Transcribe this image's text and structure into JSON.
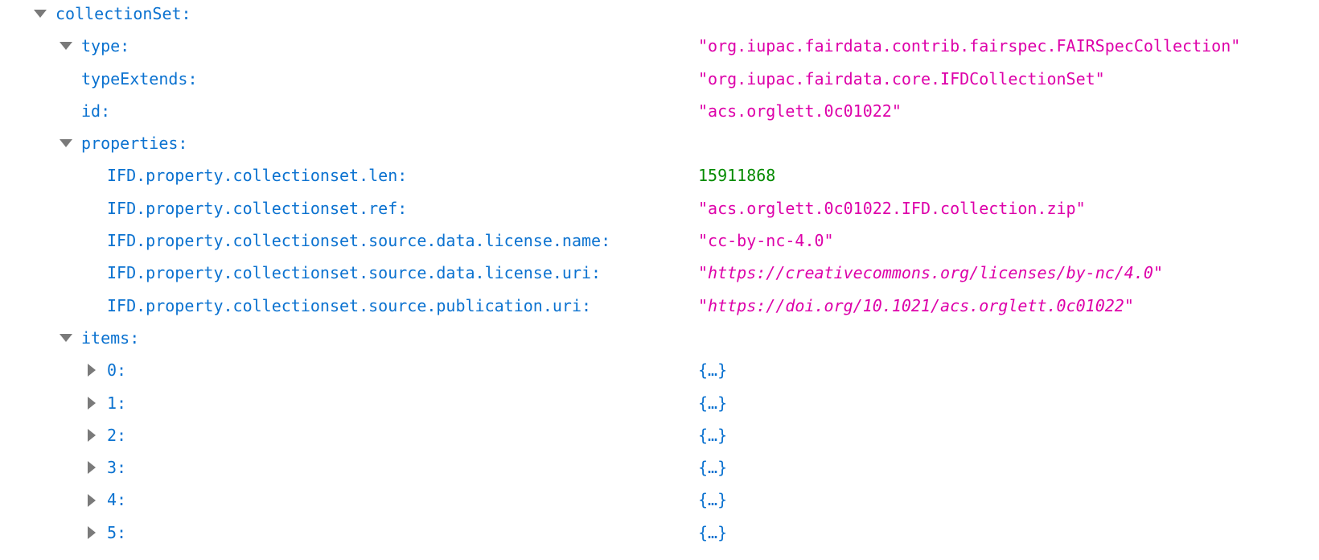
{
  "root": {
    "key": "collectionSet:"
  },
  "fields": {
    "type": {
      "key": "type:",
      "value": "\"org.iupac.fairdata.contrib.fairspec.FAIRSpecCollection\""
    },
    "typeExtends": {
      "key": "typeExtends:",
      "value": "\"org.iupac.fairdata.core.IFDCollectionSet\""
    },
    "id": {
      "key": "id:",
      "value": "\"acs.orglett.0c01022\""
    }
  },
  "properties": {
    "key": "properties:",
    "entries": [
      {
        "key": "IFD.property.collectionset.len:",
        "value": "15911868"
      },
      {
        "key": "IFD.property.collectionset.ref:",
        "value": "\"acs.orglett.0c01022.IFD.collection.zip\""
      },
      {
        "key": "IFD.property.collectionset.source.data.license.name:",
        "value": "\"cc-by-nc-4.0\""
      },
      {
        "key": "IFD.property.collectionset.source.data.license.uri:",
        "value": "https://creativecommons.org/licenses/by-nc/4.0"
      },
      {
        "key": "IFD.property.collectionset.source.publication.uri:",
        "value": "https://doi.org/10.1021/acs.orglett.0c01022"
      }
    ]
  },
  "items": {
    "key": "items:",
    "entries": [
      {
        "key": "0:",
        "value": "{…}"
      },
      {
        "key": "1:",
        "value": "{…}"
      },
      {
        "key": "2:",
        "value": "{…}"
      },
      {
        "key": "3:",
        "value": "{…}"
      },
      {
        "key": "4:",
        "value": "{…}"
      },
      {
        "key": "5:",
        "value": "{…}"
      }
    ]
  },
  "quote": "\"",
  "icons": {
    "expanded": "triangle-down-icon",
    "collapsed": "triangle-right-icon"
  },
  "colors": {
    "key": "#0b72d0",
    "string": "#dd00a9",
    "number": "#058b00",
    "twisty": "#7a7a7a"
  }
}
